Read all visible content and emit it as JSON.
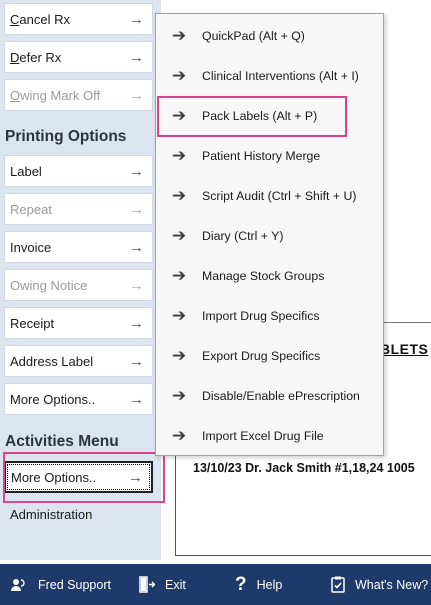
{
  "sidebar": {
    "rx_buttons": [
      {
        "label": "Cancel Rx",
        "accel": "C",
        "rest": "ancel Rx",
        "disabled": false
      },
      {
        "label": "Defer Rx",
        "accel": "D",
        "rest": "efer Rx",
        "disabled": false
      },
      {
        "label": "Owing Mark Off",
        "accel": "O",
        "rest": "wing Mark Off",
        "disabled": true
      }
    ],
    "printing_heading": "Printing Options",
    "printing_buttons": [
      {
        "label": "Label",
        "disabled": false
      },
      {
        "label": "Repeat",
        "disabled": true
      },
      {
        "label": "Invoice",
        "disabled": false
      },
      {
        "label": "Owing Notice",
        "disabled": true
      },
      {
        "label": "Receipt",
        "disabled": false
      },
      {
        "label": "Address Label",
        "disabled": false
      },
      {
        "label": "More Options..",
        "disabled": false
      }
    ],
    "activities_heading": "Activities Menu",
    "activities_buttons": [
      {
        "label": "More Options.."
      },
      {
        "label": "Administration"
      }
    ],
    "arrow_icon": "→"
  },
  "popup_menu": {
    "items": [
      {
        "label": "QuickPad (Alt + Q)"
      },
      {
        "label": "Clinical Interventions (Alt + I)"
      },
      {
        "label": "Pack Labels (Alt + P)"
      },
      {
        "label": "Patient History Merge"
      },
      {
        "label": "Script Audit (Ctrl + Shift + U)"
      },
      {
        "label": "Diary (Ctrl + Y)"
      },
      {
        "label": "Manage Stock Groups"
      },
      {
        "label": "Import Drug Specifics"
      },
      {
        "label": "Export Drug Specifics"
      },
      {
        "label": "Disable/Enable ePrescription"
      },
      {
        "label": "Import Excel Drug File"
      }
    ],
    "arrow_icon": "➔"
  },
  "document": {
    "title_fragment": "BLETS",
    "line": "13/10/23  Dr. Jack Smith #1,18,24  1005"
  },
  "bottom_bar": {
    "items": [
      {
        "label": "Fred Support",
        "icon": "support-icon"
      },
      {
        "label": "Exit",
        "icon": "exit-icon"
      },
      {
        "label": "Help",
        "icon": "help-icon"
      },
      {
        "label": "What's New?",
        "icon": "whats-new-icon"
      }
    ]
  },
  "colors": {
    "sidebar_bg": "#dce4ef",
    "highlight": "#d9448a",
    "bottom_bar": "#1d3a6b"
  }
}
